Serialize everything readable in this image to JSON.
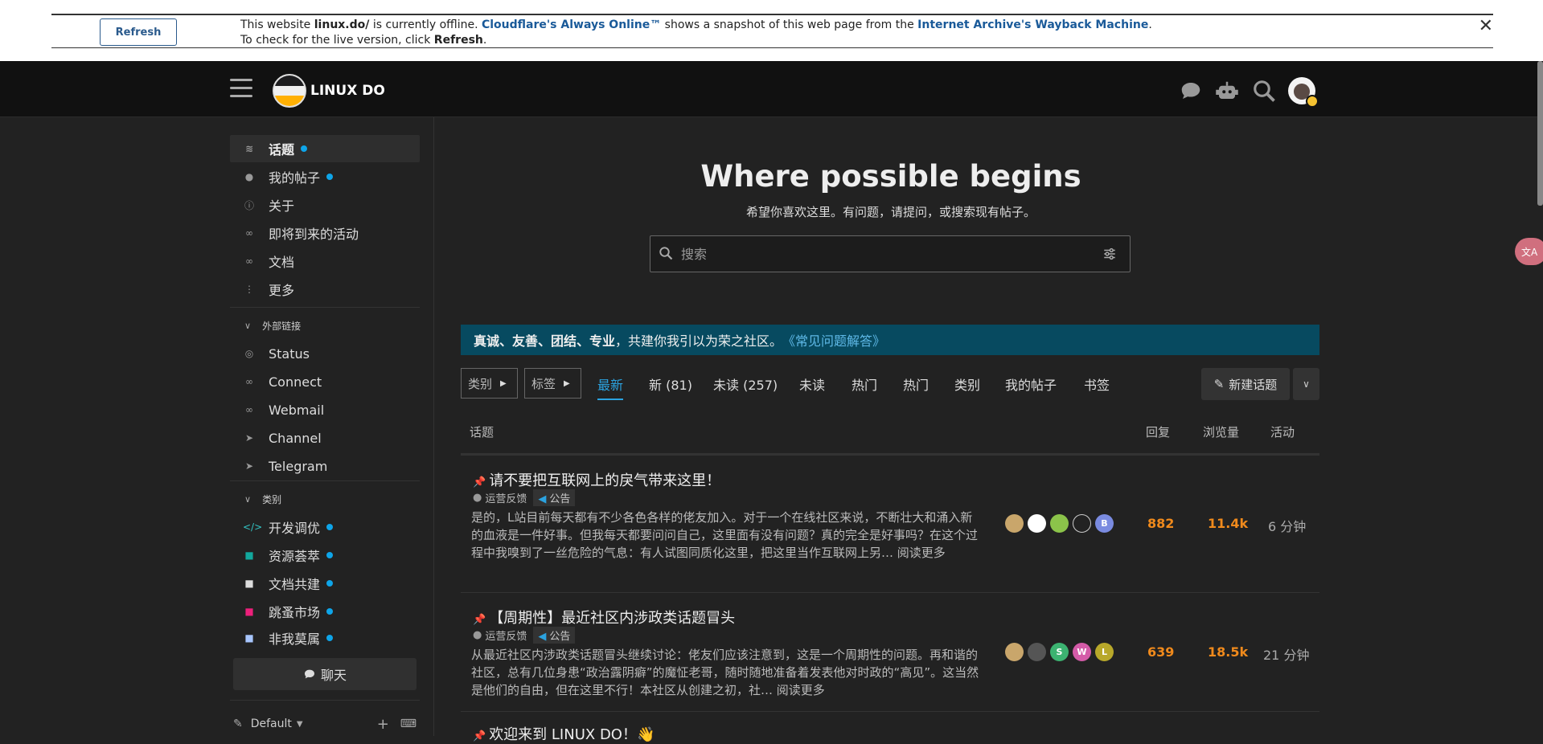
{
  "offline": {
    "refresh_button": "Refresh",
    "text_prefix": "This website ",
    "site": "linux.do/",
    "text_mid1": " is currently offline. ",
    "cloudflare_link": "Cloudflare's Always Online™",
    "text_mid2": " shows a snapshot of this web page from the ",
    "archive_link": "Internet Archive's Wayback Machine",
    "text_mid3": ". To check for the live version, click ",
    "refresh_word": "Refresh",
    "text_end": ".",
    "close": "✕"
  },
  "header": {
    "site_name": "LINUX DO"
  },
  "sidebar": {
    "items": [
      {
        "label": "话题",
        "icon": "layers-icon",
        "dot": true
      },
      {
        "label": "我的帖子",
        "icon": "user-icon",
        "dot": true
      },
      {
        "label": "关于",
        "icon": "info-icon",
        "dot": false
      },
      {
        "label": "即将到来的活动",
        "icon": "link-icon",
        "dot": false
      },
      {
        "label": "文档",
        "icon": "link-icon",
        "dot": false
      },
      {
        "label": "更多",
        "icon": "more-vertical-icon",
        "dot": false
      }
    ],
    "section_links": "外部链接",
    "links": [
      {
        "label": "Status",
        "icon": "eye-icon"
      },
      {
        "label": "Connect",
        "icon": "link-icon"
      },
      {
        "label": "Webmail",
        "icon": "link-icon"
      },
      {
        "label": "Channel",
        "icon": "send-icon"
      },
      {
        "label": "Telegram",
        "icon": "send-icon"
      }
    ],
    "section_categories": "类别",
    "categories": [
      {
        "label": "开发调优",
        "icon": "code-icon",
        "color": "#32c3c3"
      },
      {
        "label": "资源荟萃",
        "icon": "share-icon",
        "color": "#12a89d"
      },
      {
        "label": "文档共建",
        "icon": "book-icon",
        "color": "#dddddd"
      },
      {
        "label": "跳蚤市场",
        "icon": "tag-icon",
        "color": "#ed207b"
      },
      {
        "label": "非我莫属",
        "icon": "briefcase-icon",
        "color": "#a8c6fe"
      }
    ],
    "chat_button": "聊天",
    "footer_theme": "Default"
  },
  "hero": {
    "title": "Where possible begins",
    "subtitle": "希望你喜欢这里。有问题，请提问，或搜索现有帖子。",
    "search_placeholder": "搜索"
  },
  "notice": {
    "bold_text": "真诚、友善、团结、专业",
    "text": "，共建你我引以为荣之社区。",
    "link": "《常见问题解答》"
  },
  "nav": {
    "category_drop": "类别",
    "tag_drop": "标签",
    "tabs": [
      "最新",
      "新 (81)",
      "未读 (257)",
      "未读",
      "热门",
      "热门",
      "类别",
      "我的帖子",
      "书签"
    ],
    "new_topic": "新建话题"
  },
  "table": {
    "col_topic": "话题",
    "col_replies": "回复",
    "col_views": "浏览量",
    "col_activity": "活动"
  },
  "topics": [
    {
      "title": "请不要把互联网上的戾气带来这里！",
      "category": "运营反馈",
      "tag": "公告",
      "excerpt": "是的，L站目前每天都有不少各色各样的佬友加入。对于一个在线社区来说，不断壮大和涌入新的血液是一件好事。但我每天都要问问自己，这里面有没有问题？真的完全是好事吗？在这个过程中我嗅到了一丝危险的气息：有人试图同质化这里，把这里当作互联网上另… 阅读更多",
      "posters": [
        {
          "letter": "",
          "color": "#c9a66b"
        },
        {
          "letter": "",
          "color": "#ffffff"
        },
        {
          "letter": "",
          "color": "#8bc34a"
        },
        {
          "letter": "",
          "color": "#222222"
        },
        {
          "letter": "B",
          "color": "#7a8be0"
        }
      ],
      "replies": "882",
      "views": "11.4k",
      "activity": "6 分钟"
    },
    {
      "title": "【周期性】最近社区内涉政类话题冒头",
      "category": "运营反馈",
      "tag": "公告",
      "excerpt": "从最近社区内涉政类话题冒头继续讨论：佬友们应该注意到，这是一个周期性的问题。再和谐的社区，总有几位身患“政治露阴癖”的魔怔老哥，随时随地准备着发表他对时政的“高见”。这当然是他们的自由，但在这里不行！本社区从创建之初，社… 阅读更多",
      "posters": [
        {
          "letter": "",
          "color": "#c9a66b"
        },
        {
          "letter": "",
          "color": "#555555"
        },
        {
          "letter": "S",
          "color": "#3cb371"
        },
        {
          "letter": "W",
          "color": "#d45ba8"
        },
        {
          "letter": "L",
          "color": "#b8a82a"
        }
      ],
      "replies": "639",
      "views": "18.5k",
      "activity": "21 分钟"
    },
    {
      "title": "欢迎来到 LINUX DO！👋"
    }
  ]
}
